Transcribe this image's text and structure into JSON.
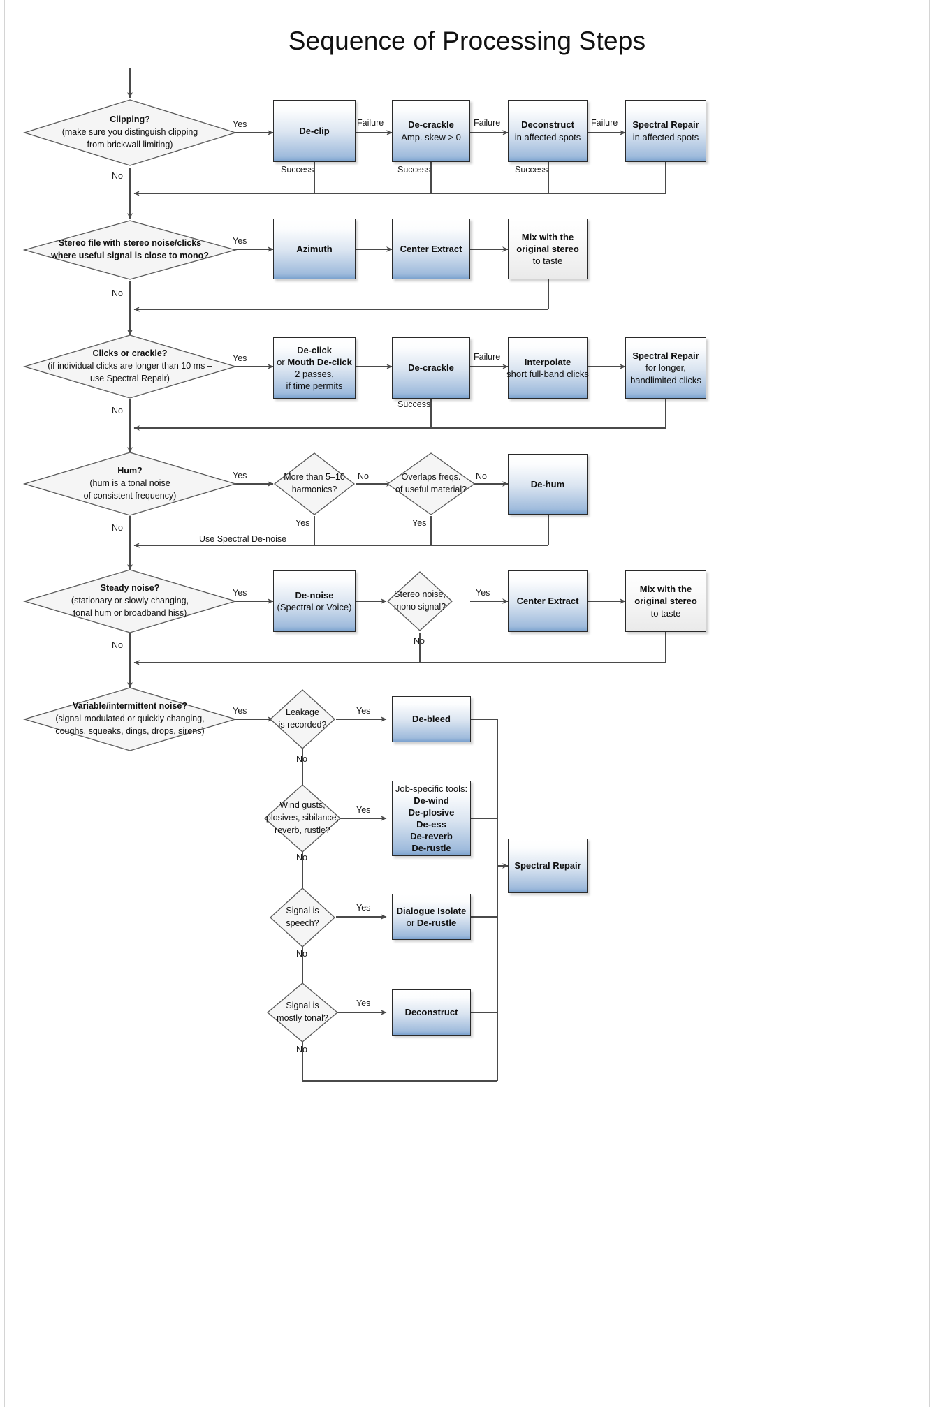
{
  "title": "Sequence of Processing Steps",
  "colors": {
    "process_fill_top": "#ffffff",
    "process_fill_bottom": "#7ba2ce",
    "neutral_fill": "#efefef",
    "line": "#4a4a4a",
    "text": "#0f0f0f"
  },
  "labels": {
    "yes": "Yes",
    "no": "No",
    "success": "Success",
    "failure": "Failure",
    "use_spectral_denoise": "Use Spectral De-noise"
  },
  "rows": [
    {
      "id": "clipping",
      "decision": {
        "title": "Clipping?",
        "line2": "(make sure you distinguish clipping",
        "line3": "from brickwall limiting)"
      },
      "steps": [
        {
          "id": "de-clip",
          "title": "De-clip",
          "sub": ""
        },
        {
          "id": "de-crackle",
          "title": "De-crackle",
          "sub": "Amp. skew > 0"
        },
        {
          "id": "deconstruct",
          "title": "Deconstruct",
          "sub": "in affected spots"
        },
        {
          "id": "spectral-repair",
          "title": "Spectral Repair",
          "sub": "in affected spots"
        }
      ]
    },
    {
      "id": "stereo-file",
      "decision": {
        "title": "Stereo file with stereo noise/clicks",
        "line2": "where useful signal is close to mono?",
        "line3": ""
      },
      "steps": [
        {
          "id": "azimuth",
          "title": "Azimuth",
          "sub": ""
        },
        {
          "id": "center-extract",
          "title": "Center Extract",
          "sub": ""
        },
        {
          "id": "mix",
          "title": "Mix with the",
          "title2": "original stereo",
          "sub": "to taste"
        }
      ]
    },
    {
      "id": "clicks",
      "decision": {
        "title": "Clicks or crackle?",
        "line2": "(if individual clicks are longer than 10 ms –",
        "line3": "use Spectral Repair)"
      },
      "steps": [
        {
          "id": "de-click",
          "title": "De-click",
          "title2": "or Mouth De-click",
          "sub": "2 passes,",
          "sub2": "if time permits"
        },
        {
          "id": "de-crackle-2",
          "title": "De-crackle",
          "sub": ""
        },
        {
          "id": "interpolate",
          "title": "Interpolate",
          "sub": "short full-band clicks"
        },
        {
          "id": "spectral-repair-2",
          "title": "Spectral Repair",
          "sub": "for longer,",
          "sub2": "bandlimited clicks"
        }
      ]
    },
    {
      "id": "hum",
      "decision": {
        "title": "Hum?",
        "line2": "(hum is a tonal noise",
        "line3": "of consistent frequency)"
      },
      "sub_decisions": [
        {
          "id": "harmonics",
          "line1": "More than 5–10",
          "line2": "harmonics?"
        },
        {
          "id": "overlaps",
          "line1": "Overlaps freqs.",
          "line2": "of useful material?"
        }
      ],
      "steps": [
        {
          "id": "de-hum",
          "title": "De-hum",
          "sub": ""
        }
      ]
    },
    {
      "id": "steady-noise",
      "decision": {
        "title": "Steady noise?",
        "line2": "(stationary or slowly changing,",
        "line3": "tonal hum or broadband hiss)"
      },
      "sub_decisions": [
        {
          "id": "stereo-noise-mono",
          "line1": "Stereo noise,",
          "line2": "mono signal?"
        }
      ],
      "steps": [
        {
          "id": "de-noise",
          "title": "De-noise",
          "sub": "(Spectral or Voice)"
        },
        {
          "id": "center-extract-2",
          "title": "Center Extract",
          "sub": ""
        },
        {
          "id": "mix-2",
          "title": "Mix with the",
          "title2": "original stereo",
          "sub": "to taste"
        }
      ]
    },
    {
      "id": "variable-noise",
      "decision": {
        "title": "Variable/intermittent noise?",
        "line2": "(signal-modulated or quickly changing,",
        "line3": "coughs, squeaks, dings, drops, sirens)"
      },
      "branches": [
        {
          "decision": {
            "id": "leakage",
            "line1": "Leakage",
            "line2": "is recorded?"
          },
          "step": {
            "id": "de-bleed",
            "title": "De-bleed",
            "sub": ""
          }
        },
        {
          "decision": {
            "id": "wind-gusts",
            "line1": "Wind gusts,",
            "line2": "plosives, sibilance,",
            "line3": "reverb, rustle?"
          },
          "step": {
            "id": "job-specific-tools",
            "heading": "Job-specific tools:",
            "items": [
              "De-wind",
              "De-plosive",
              "De-ess",
              "De-reverb",
              "De-rustle"
            ]
          }
        },
        {
          "decision": {
            "id": "signal-is-speech",
            "line1": "Signal is",
            "line2": "speech?"
          },
          "step": {
            "id": "dialogue-isolate",
            "title": "Dialogue Isolate",
            "title2": "or De-rustle"
          }
        },
        {
          "decision": {
            "id": "signal-mostly-tonal",
            "line1": "Signal is",
            "line2": "mostly tonal?"
          },
          "step": {
            "id": "deconstruct-2",
            "title": "Deconstruct",
            "sub": ""
          }
        }
      ],
      "final_step": {
        "id": "spectral-repair-3",
        "title": "Spectral Repair",
        "sub": ""
      }
    }
  ]
}
